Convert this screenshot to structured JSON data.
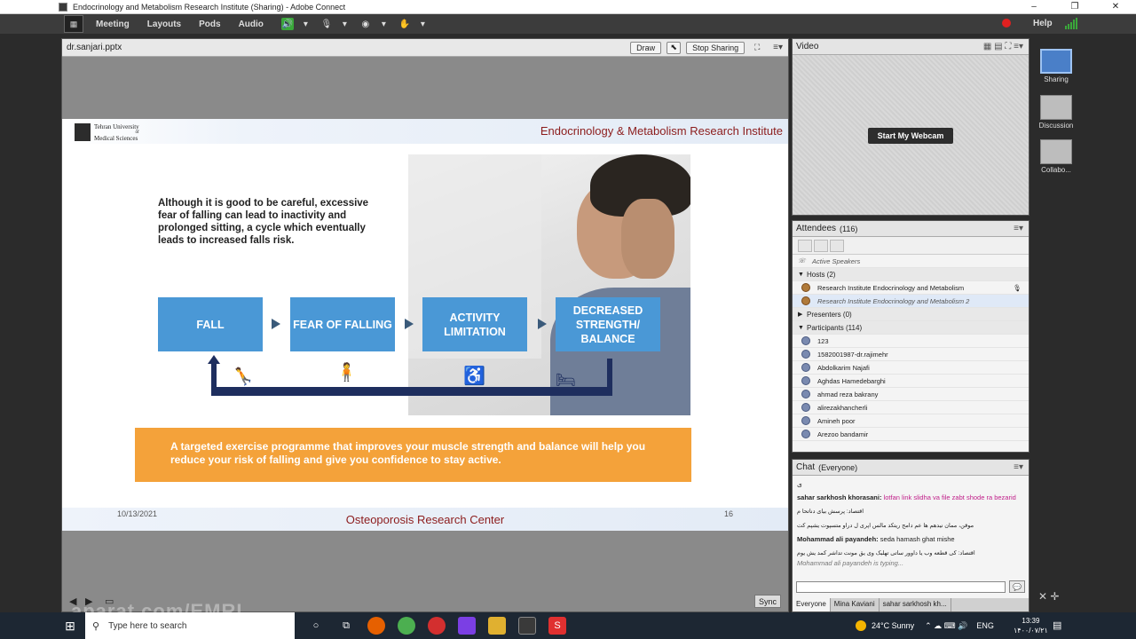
{
  "window": {
    "title": "Endocrinology and Metabolism Research Institute (Sharing) - Adobe Connect",
    "minimize": "–",
    "maximize": "❐",
    "close": "✕"
  },
  "menubar": {
    "items": [
      "Meeting",
      "Layouts",
      "Pods",
      "Audio"
    ],
    "help": "Help"
  },
  "share_pod": {
    "filename": "dr.sanjari.pptx",
    "draw_label": "Draw",
    "stop_sharing_label": "Stop Sharing",
    "sync_label": "Sync",
    "prev": "◀",
    "next": "▶"
  },
  "slide": {
    "university_line1": "Tehran University",
    "university_line2": "of",
    "university_line3": "Medical Sciences",
    "institute": "Endocrinology & Metabolism Research Institute",
    "intro_text": "Although it is good to be careful, excessive fear of falling can lead to inactivity and prolonged sitting, a cycle which eventually leads to increased falls risk.",
    "flow": [
      "FALL",
      "FEAR OF FALLING",
      "ACTIVITY LIMITATION",
      "DECREASED STRENGTH/ BALANCE"
    ],
    "banner": "A targeted exercise programme that improves your muscle strength and balance will help you reduce your risk of falling and give you confidence to stay active.",
    "date": "10/13/2021",
    "footer_center": "Osteoporosis Research Center",
    "page_number": "16"
  },
  "video_pod": {
    "title": "Video",
    "webcam_button": "Start My Webcam"
  },
  "attendees_pod": {
    "title": "Attendees",
    "count": "(116)",
    "active_speakers": "Active Speakers",
    "hosts_label": "Hosts (2)",
    "hosts": [
      "Research Institute  Endocrinology and Metabolism",
      "Research Institute  Endocrinology and Metabolism  2"
    ],
    "presenters_label": "Presenters (0)",
    "participants_label": "Participants (114)",
    "participants": [
      "123",
      "1582001987-dr.rajimehr",
      "Abdolkarim Najafi",
      "Aghdas Hamedebarghi",
      "ahmad reza bakrany",
      "alirezakhancherli",
      "Amineh poor",
      "Arezoo  bandamir"
    ]
  },
  "chat_pod": {
    "title": "Chat",
    "scope": "(Everyone)",
    "messages": [
      {
        "who": "",
        "text": "ی"
      },
      {
        "who": "sahar sarkhosh khorasani:",
        "text": "lotfan link slidha va file zabt shode ra bezarid"
      },
      {
        "who": "",
        "text": "اقتصاد: پرسش بیای دناتحا م"
      },
      {
        "who": "",
        "text": "موقن، ممان نیدهم ها عم دامح ریتکد مالس اپری ل دراو متسپوت یشپم کت"
      },
      {
        "who": "Mohammad ali payandeh:",
        "text": "seda hamash ghat mishe"
      },
      {
        "who": "",
        "text": "اقتصاد: کی قطعه وب یا داوور ساتی تهلبک وی یق مونت تداشر کمد یش یوم"
      }
    ],
    "typing": "Mohammad ali payandeh is typing...",
    "tabs": [
      "Everyone",
      "Mina Kaviani",
      "sahar sarkhosh kh..."
    ]
  },
  "layouts": [
    {
      "label": "Sharing"
    },
    {
      "label": "Discussion"
    },
    {
      "label": "Collabo..."
    }
  ],
  "watermark": "aparat.com/EMRI",
  "taskbar": {
    "search_placeholder": "Type here to search",
    "weather": "24°C  Sunny",
    "lang": "ENG",
    "time": "13:39",
    "date": "۱۴۰۰/۰۷/۲۱"
  }
}
